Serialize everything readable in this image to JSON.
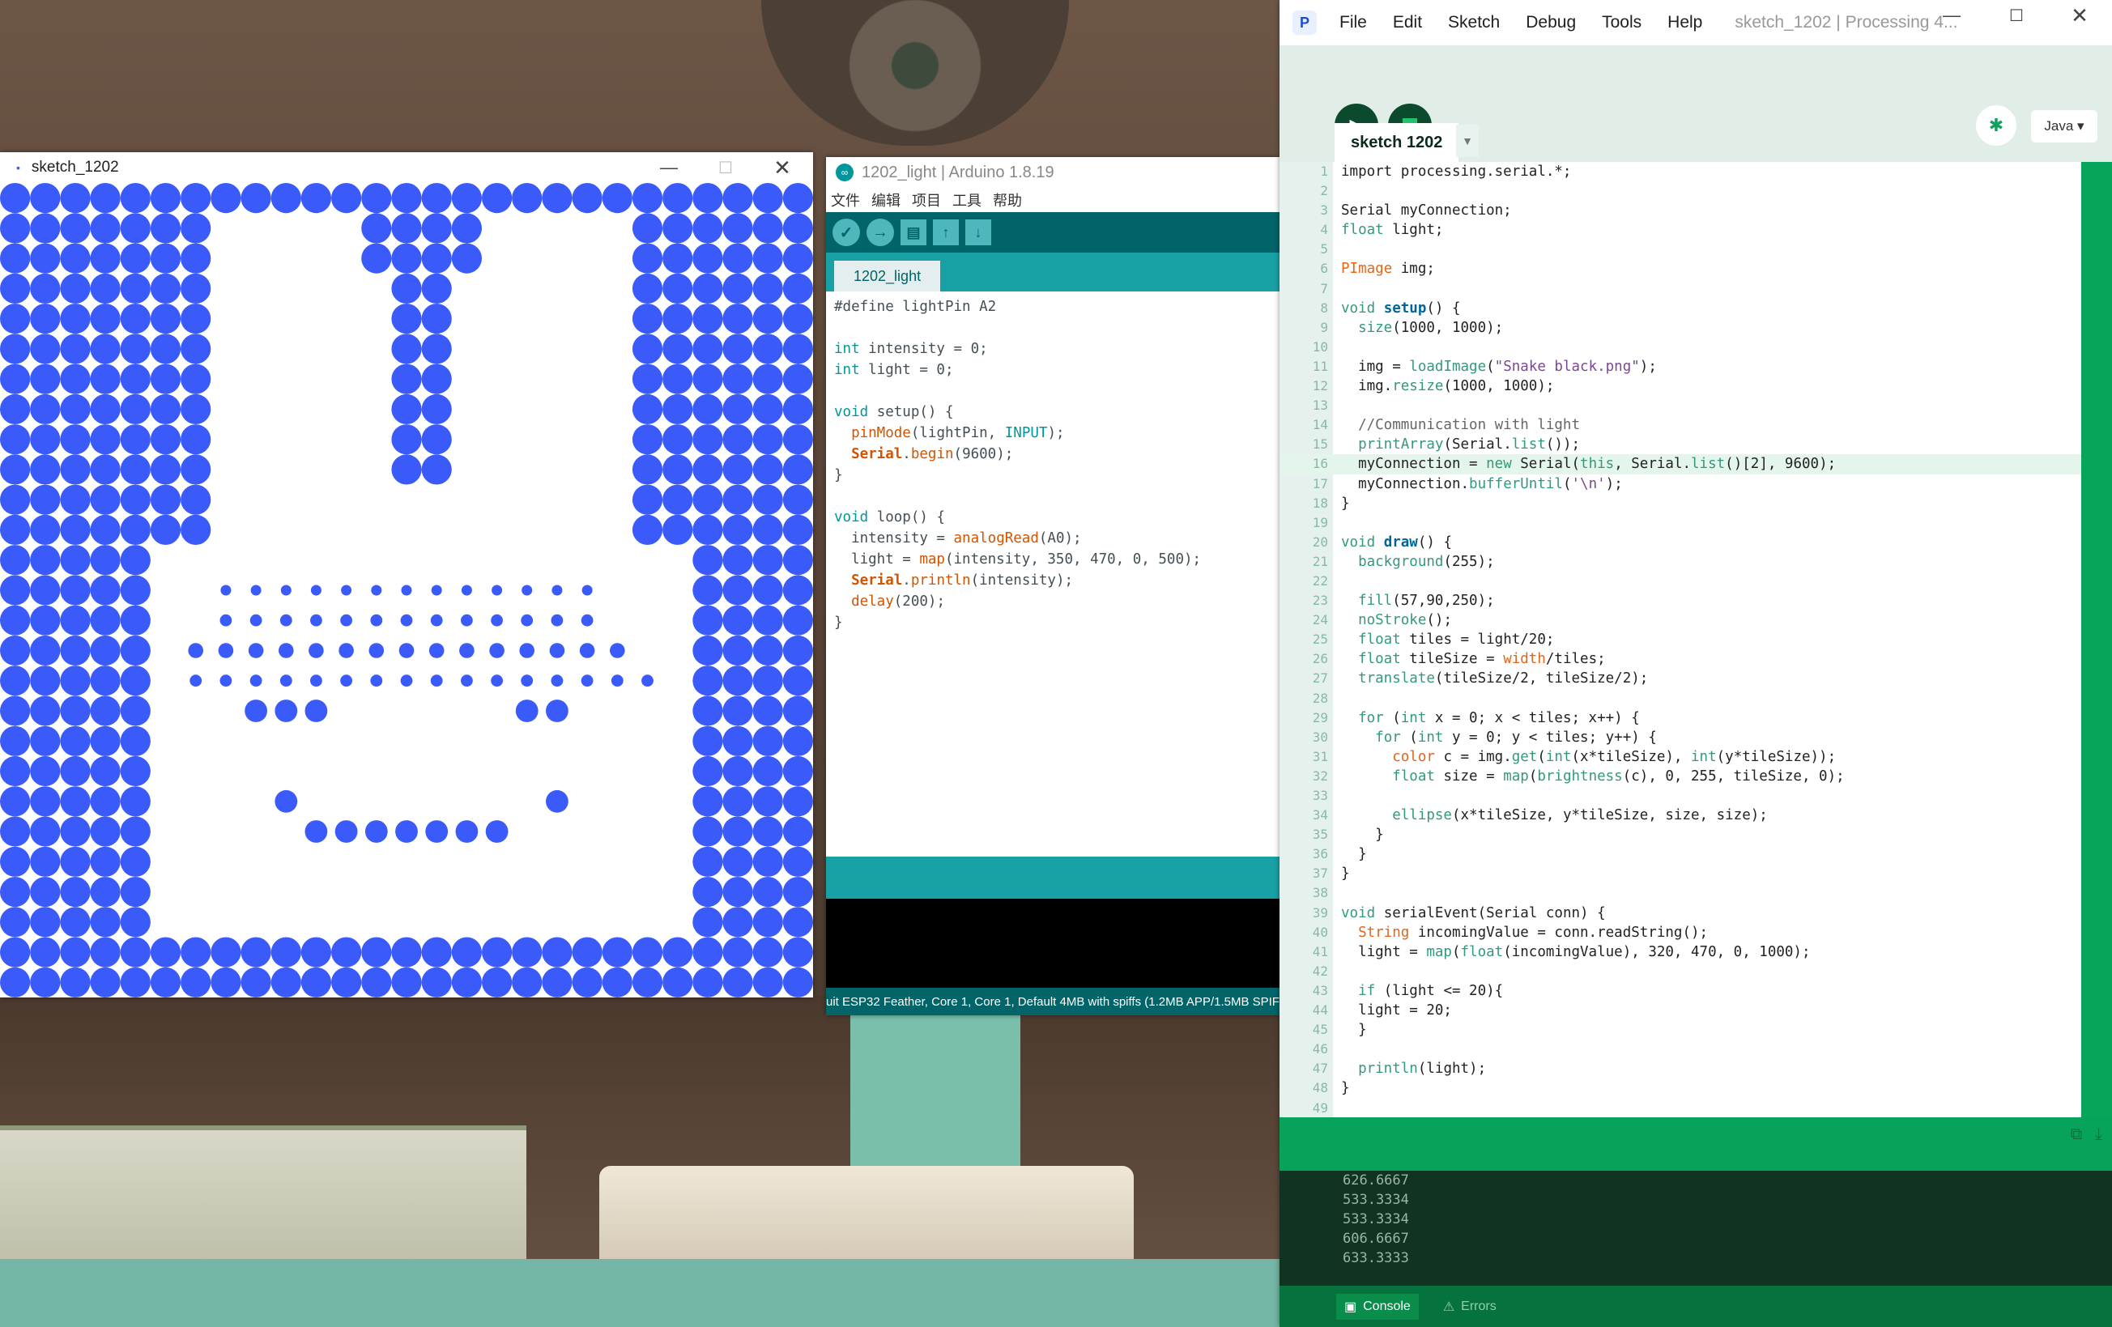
{
  "sketch_window": {
    "title": "sketch_1202",
    "dot_color": "#3a5bfa"
  },
  "arduino_window": {
    "title": "1202_light | Arduino 1.8.19",
    "menu": [
      "文件",
      "编辑",
      "项目",
      "工具",
      "帮助"
    ],
    "tab": "1202_light",
    "code": [
      [
        {
          "t": "#define lightPin A2",
          "c": ""
        }
      ],
      [],
      [
        {
          "t": "int",
          "c": "ak"
        },
        {
          "t": " intensity = 0;",
          "c": ""
        }
      ],
      [
        {
          "t": "int",
          "c": "ak"
        },
        {
          "t": " light = 0;",
          "c": ""
        }
      ],
      [],
      [
        {
          "t": "void",
          "c": "ak"
        },
        {
          "t": " setup() {",
          "c": ""
        }
      ],
      [
        {
          "t": "  ",
          "c": ""
        },
        {
          "t": "pinMode",
          "c": "af"
        },
        {
          "t": "(lightPin, ",
          "c": ""
        },
        {
          "t": "INPUT",
          "c": "ak"
        },
        {
          "t": ");",
          "c": ""
        }
      ],
      [
        {
          "t": "  ",
          "c": ""
        },
        {
          "t": "Serial",
          "c": "ab"
        },
        {
          "t": ".",
          "c": ""
        },
        {
          "t": "begin",
          "c": "af"
        },
        {
          "t": "(9600);",
          "c": ""
        }
      ],
      [
        {
          "t": "}",
          "c": ""
        }
      ],
      [],
      [
        {
          "t": "void",
          "c": "ak"
        },
        {
          "t": " loop() {",
          "c": ""
        }
      ],
      [
        {
          "t": "  intensity = ",
          "c": ""
        },
        {
          "t": "analogRead",
          "c": "af"
        },
        {
          "t": "(A0);",
          "c": ""
        }
      ],
      [
        {
          "t": "  light = ",
          "c": ""
        },
        {
          "t": "map",
          "c": "af"
        },
        {
          "t": "(intensity, 350, 470, 0, 500);",
          "c": ""
        }
      ],
      [
        {
          "t": "  ",
          "c": ""
        },
        {
          "t": "Serial",
          "c": "ab"
        },
        {
          "t": ".",
          "c": ""
        },
        {
          "t": "println",
          "c": "af"
        },
        {
          "t": "(intensity);",
          "c": ""
        }
      ],
      [
        {
          "t": "  ",
          "c": ""
        },
        {
          "t": "delay",
          "c": "af"
        },
        {
          "t": "(200);",
          "c": ""
        }
      ],
      [
        {
          "t": "}",
          "c": ""
        }
      ]
    ],
    "footer": "uit ESP32 Feather, Core 1, Core 1, Default 4MB with spiffs (1.2MB APP/1.5MB SPIFFS"
  },
  "processing_window": {
    "menu": [
      "File",
      "Edit",
      "Sketch",
      "Debug",
      "Tools",
      "Help"
    ],
    "title": "sketch_1202 | Processing 4...",
    "mode": "Java ▾",
    "tab": "sketch 1202",
    "highlight_line": 16,
    "code": [
      [
        {
          "t": "import processing.serial.*;",
          "c": ""
        }
      ],
      [],
      [
        {
          "t": "Serial myConnection;",
          "c": ""
        }
      ],
      [
        {
          "t": "float",
          "c": "k"
        },
        {
          "t": " light;",
          "c": ""
        }
      ],
      [],
      [
        {
          "t": "PImage",
          "c": "t"
        },
        {
          "t": " img;",
          "c": ""
        }
      ],
      [],
      [
        {
          "t": "void",
          "c": "k"
        },
        {
          "t": " ",
          "c": ""
        },
        {
          "t": "setup",
          "c": "f"
        },
        {
          "t": "() {",
          "c": ""
        }
      ],
      [
        {
          "t": "  ",
          "c": ""
        },
        {
          "t": "size",
          "c": "k"
        },
        {
          "t": "(1000, 1000);",
          "c": ""
        }
      ],
      [],
      [
        {
          "t": "  img = ",
          "c": ""
        },
        {
          "t": "loadImage",
          "c": "k"
        },
        {
          "t": "(",
          "c": ""
        },
        {
          "t": "\"Snake black.png\"",
          "c": "s"
        },
        {
          "t": ");",
          "c": ""
        }
      ],
      [
        {
          "t": "  img.",
          "c": ""
        },
        {
          "t": "resize",
          "c": "k"
        },
        {
          "t": "(1000, 1000);",
          "c": ""
        }
      ],
      [],
      [
        {
          "t": "  //Communication with light",
          "c": "c"
        }
      ],
      [
        {
          "t": "  ",
          "c": ""
        },
        {
          "t": "printArray",
          "c": "k"
        },
        {
          "t": "(Serial.",
          "c": ""
        },
        {
          "t": "list",
          "c": "k"
        },
        {
          "t": "());",
          "c": ""
        }
      ],
      [
        {
          "t": "  myConnection = ",
          "c": ""
        },
        {
          "t": "new",
          "c": "k"
        },
        {
          "t": " Serial(",
          "c": ""
        },
        {
          "t": "this",
          "c": "k"
        },
        {
          "t": ", Serial.",
          "c": ""
        },
        {
          "t": "list",
          "c": "k"
        },
        {
          "t": "()[2], 9600);",
          "c": ""
        }
      ],
      [
        {
          "t": "  myConnection.",
          "c": ""
        },
        {
          "t": "bufferUntil",
          "c": "k"
        },
        {
          "t": "(",
          "c": ""
        },
        {
          "t": "'\\n'",
          "c": "s"
        },
        {
          "t": ");",
          "c": ""
        }
      ],
      [
        {
          "t": "}",
          "c": ""
        }
      ],
      [],
      [
        {
          "t": "void",
          "c": "k"
        },
        {
          "t": " ",
          "c": ""
        },
        {
          "t": "draw",
          "c": "f"
        },
        {
          "t": "() {",
          "c": ""
        }
      ],
      [
        {
          "t": "  ",
          "c": ""
        },
        {
          "t": "background",
          "c": "k"
        },
        {
          "t": "(255);",
          "c": ""
        }
      ],
      [],
      [
        {
          "t": "  ",
          "c": ""
        },
        {
          "t": "fill",
          "c": "k"
        },
        {
          "t": "(57,90,250);",
          "c": ""
        }
      ],
      [
        {
          "t": "  ",
          "c": ""
        },
        {
          "t": "noStroke",
          "c": "k"
        },
        {
          "t": "();",
          "c": ""
        }
      ],
      [
        {
          "t": "  ",
          "c": ""
        },
        {
          "t": "float",
          "c": "k"
        },
        {
          "t": " tiles = light/20;",
          "c": ""
        }
      ],
      [
        {
          "t": "  ",
          "c": ""
        },
        {
          "t": "float",
          "c": "k"
        },
        {
          "t": " tileSize = ",
          "c": ""
        },
        {
          "t": "width",
          "c": "t"
        },
        {
          "t": "/tiles;",
          "c": ""
        }
      ],
      [
        {
          "t": "  ",
          "c": ""
        },
        {
          "t": "translate",
          "c": "k"
        },
        {
          "t": "(tileSize/2, tileSize/2);",
          "c": ""
        }
      ],
      [],
      [
        {
          "t": "  ",
          "c": ""
        },
        {
          "t": "for",
          "c": "k"
        },
        {
          "t": " (",
          "c": ""
        },
        {
          "t": "int",
          "c": "k"
        },
        {
          "t": " x = 0; x < tiles; x++) {",
          "c": ""
        }
      ],
      [
        {
          "t": "    ",
          "c": ""
        },
        {
          "t": "for",
          "c": "k"
        },
        {
          "t": " (",
          "c": ""
        },
        {
          "t": "int",
          "c": "k"
        },
        {
          "t": " y = 0; y < tiles; y++) {",
          "c": ""
        }
      ],
      [
        {
          "t": "      ",
          "c": ""
        },
        {
          "t": "color",
          "c": "t"
        },
        {
          "t": " c = img.",
          "c": ""
        },
        {
          "t": "get",
          "c": "k"
        },
        {
          "t": "(",
          "c": ""
        },
        {
          "t": "int",
          "c": "k"
        },
        {
          "t": "(x*tileSize), ",
          "c": ""
        },
        {
          "t": "int",
          "c": "k"
        },
        {
          "t": "(y*tileSize));",
          "c": ""
        }
      ],
      [
        {
          "t": "      ",
          "c": ""
        },
        {
          "t": "float",
          "c": "k"
        },
        {
          "t": " size = ",
          "c": ""
        },
        {
          "t": "map",
          "c": "k"
        },
        {
          "t": "(",
          "c": ""
        },
        {
          "t": "brightness",
          "c": "k"
        },
        {
          "t": "(c), 0, 255, tileSize, 0);",
          "c": ""
        }
      ],
      [],
      [
        {
          "t": "      ",
          "c": ""
        },
        {
          "t": "ellipse",
          "c": "k"
        },
        {
          "t": "(x*tileSize, y*tileSize, size, size);",
          "c": ""
        }
      ],
      [
        {
          "t": "    }",
          "c": ""
        }
      ],
      [
        {
          "t": "  }",
          "c": ""
        }
      ],
      [
        {
          "t": "}",
          "c": ""
        }
      ],
      [],
      [
        {
          "t": "void",
          "c": "k"
        },
        {
          "t": " serialEvent(Serial conn) {",
          "c": ""
        }
      ],
      [
        {
          "t": "  ",
          "c": ""
        },
        {
          "t": "String",
          "c": "t"
        },
        {
          "t": " incomingValue = conn.readString();",
          "c": ""
        }
      ],
      [
        {
          "t": "  light = ",
          "c": ""
        },
        {
          "t": "map",
          "c": "k"
        },
        {
          "t": "(",
          "c": ""
        },
        {
          "t": "float",
          "c": "k"
        },
        {
          "t": "(incomingValue), 320, 470, 0, 1000);",
          "c": ""
        }
      ],
      [],
      [
        {
          "t": "  ",
          "c": ""
        },
        {
          "t": "if",
          "c": "k"
        },
        {
          "t": " (light <= 20){",
          "c": ""
        }
      ],
      [
        {
          "t": "  light = 20;",
          "c": ""
        }
      ],
      [
        {
          "t": "  }",
          "c": ""
        }
      ],
      [],
      [
        {
          "t": "  ",
          "c": ""
        },
        {
          "t": "println",
          "c": "k"
        },
        {
          "t": "(light);",
          "c": ""
        }
      ],
      [
        {
          "t": "}",
          "c": ""
        }
      ],
      []
    ],
    "console": [
      "626.6667",
      "533.3334",
      "533.3334",
      "606.6667",
      "633.3333"
    ],
    "footer_tabs": [
      "Console",
      "Errors"
    ]
  }
}
